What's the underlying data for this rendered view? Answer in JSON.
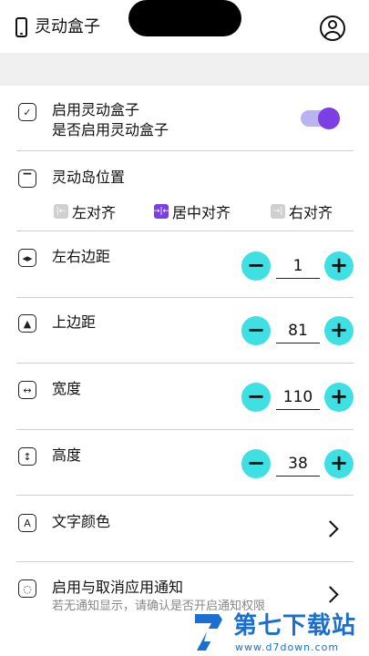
{
  "header": {
    "title": "灵动盒子",
    "phone_icon": "phone-icon",
    "profile_icon": "user-circle-icon"
  },
  "enable": {
    "label": "启用灵动盒子",
    "sub": "是否启用灵动盒子",
    "toggle_on": true,
    "accent": "#7b3fe4"
  },
  "position": {
    "label": "灵动岛位置",
    "options": [
      {
        "label": "左对齐",
        "selected": false
      },
      {
        "label": "居中对齐",
        "selected": true
      },
      {
        "label": "右对齐",
        "selected": false
      }
    ]
  },
  "margins": {
    "lr": {
      "label": "左右边距",
      "value": "1"
    },
    "top": {
      "label": "上边距",
      "value": "81"
    },
    "width": {
      "label": "宽度",
      "value": "110"
    },
    "height": {
      "label": "高度",
      "value": "38"
    },
    "stepper_color": "#3ee0e3"
  },
  "text_color": {
    "label": "文字颜色"
  },
  "notify": {
    "label": "启用与取消应用通知",
    "sub": "若无通知显示，请确认是否开启通知权限"
  },
  "watermark": {
    "title": "第七下载站",
    "url": "www.d7down.com"
  }
}
